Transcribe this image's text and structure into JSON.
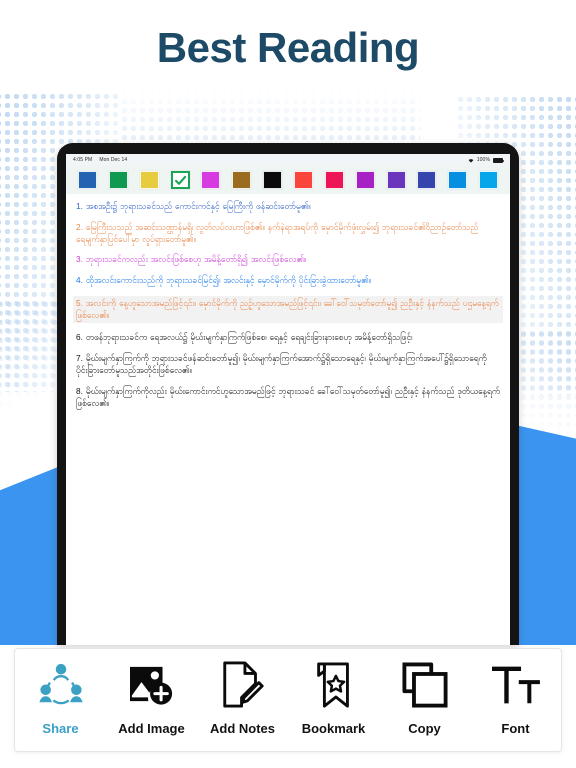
{
  "headline": "Best Reading",
  "theme": {
    "headline_color": "#1d4a66",
    "accent_blue": "#3b95f0",
    "active_tool_color": "#3aa0c4",
    "dot_pattern_color": "#b8d4f0",
    "palette_strip_bg": "#eef5f3",
    "tablet_frame": "#141414"
  },
  "tablet": {
    "statusbar": {
      "time": "4:05 PM",
      "date": "Mon Dec 14",
      "battery_percent": "100%",
      "wifi_icon": "wifi-icon",
      "battery_icon": "battery-icon"
    },
    "palette": {
      "swatches": [
        {
          "name": "blue",
          "color": "#2563b0",
          "selected": false
        },
        {
          "name": "green",
          "color": "#0e9850",
          "selected": false
        },
        {
          "name": "yellow",
          "color": "#e6cc3e",
          "selected": false
        },
        {
          "name": "white-check",
          "color": "#ffffff",
          "selected": true
        },
        {
          "name": "magenta",
          "color": "#d63ae0",
          "selected": false
        },
        {
          "name": "brown",
          "color": "#9b6b1e",
          "selected": false
        },
        {
          "name": "black",
          "color": "#0a0a0a",
          "selected": false
        },
        {
          "name": "red",
          "color": "#f9453a",
          "selected": false
        },
        {
          "name": "pink-red",
          "color": "#ed1457",
          "selected": false
        },
        {
          "name": "purple",
          "color": "#a722c4",
          "selected": false
        },
        {
          "name": "violet",
          "color": "#6a34bd",
          "selected": false
        },
        {
          "name": "indigo",
          "color": "#3645ae",
          "selected": false
        },
        {
          "name": "azure",
          "color": "#068fe0",
          "selected": false
        },
        {
          "name": "sky-blue",
          "color": "#05a6ea",
          "selected": false
        }
      ],
      "check_color": "#18a558"
    },
    "reader": {
      "verses": [
        {
          "number": "1.",
          "text": "1. အစအဦး၌ ဘုရားသခင်သည် ကောင်းကင်နှင့် မြေကြီးကို ဖန်ဆင်းတော်မူ၏။",
          "color": "#2f5ec4",
          "highlight": "none"
        },
        {
          "number": "2.",
          "text": "2. မြေကြီးသသည် အဆင်းသဏ္ဌာန်မရှိ၊ လွတ်လပ်လဟာဖြစ်၏။ နက်နဲရာအရပ်ကို မှောင်မိုက်ဖုံးလွှမ်း၍ ဘုရားသခင်၏ဝိညာဉ်တော်သည် ရေမျက်နှာပြင်ပေါ်မှာ လှုပ်ရှားတော်မူ၏။",
          "color": "#e8864a",
          "highlight": "none"
        },
        {
          "number": "3.",
          "text": "3. ဘုရားသခင်ကလည်း အလင်းဖြစ်စေဟု အမိန့်တော်ရှိ၍ အလင်းဖြစ်လေ၏။",
          "color": "#c93fd4",
          "highlight": "none"
        },
        {
          "number": "4.",
          "text": "4. ထိုအလင်းကောင်းသည်ကို ဘုရားသခင်မြင်၍၊ အလင်းနှင့် မှောင်မိုက်ကို ပိုင်းခြားခွဲထားတော်မူ၏။",
          "color": "#1b7ae8",
          "highlight": "none"
        },
        {
          "number": "5.",
          "text": "5. အလင်းကို နေ့ဟူသောအမည်ဖြင့်၎င်း၊ မှောင်မိုက်ကို ညဉ့်ဟူသောအမည်ဖြင့်၎င်း၊ ခေါ်ဝေါ်သမုတ်တော်မူ၍ ညဦးနှင့် နံနက်သည် ပဌမနေ့ရက်ဖြစ်လေ၏။",
          "color": "#e8854a",
          "highlight": "#f2f2f2"
        },
        {
          "number": "6.",
          "text": "6. တဖန်ဘုရားသခင်က ရေအလယ်၌ မိုဃ်းမျက်နှာကြက်ဖြစ်စေ၊ ရေနှင့် ရေချင်းခြားနားစေဟု အမိန့်တော်ရှိသဖြင့်၊",
          "color": "#111111",
          "highlight": "none"
        },
        {
          "number": "7.",
          "text": "7. မိုဃ်းမျက်နှာကြက်ကို ဘုရားသခင်ဖန်ဆင်းတော်မူ၍၊ မိုဃ်းမျက်နှာကြက်အောက်၌ရှိသောရေနှင့်၊ မိုဃ်းမျက်နှာကြက်အပေါ်၌ရှိသောရေကို ပိုင်းခြားတော်မူသည်အတိုင်းဖြစ်လေ၏။",
          "color": "#111111",
          "highlight": "none"
        },
        {
          "number": "8.",
          "text": "8. မိုဃ်းမျက်နှာကြက်ကိုလည်း မိုဃ်းကောင်းကင်ဟူသောအမည်ဖြင့် ဘုရားသခင် ခေါ်ဝေါ်သမုတ်တော်မူ၍၊ ညဦးနှင့် နံနက်သည် ဒုတိယနေ့ရက်ဖြစ်လေ၏။",
          "color": "#111111",
          "highlight": "none"
        }
      ]
    }
  },
  "toolbar": {
    "items": [
      {
        "label": "Share",
        "icon": "share-people-icon",
        "active": true
      },
      {
        "label": "Add Image",
        "icon": "add-image-icon",
        "active": false
      },
      {
        "label": "Add Notes",
        "icon": "note-pencil-icon",
        "active": false
      },
      {
        "label": "Bookmark",
        "icon": "bookmark-star-icon",
        "active": false
      },
      {
        "label": "Copy",
        "icon": "copy-icon",
        "active": false
      },
      {
        "label": "Font",
        "icon": "font-size-icon",
        "active": false
      }
    ]
  }
}
